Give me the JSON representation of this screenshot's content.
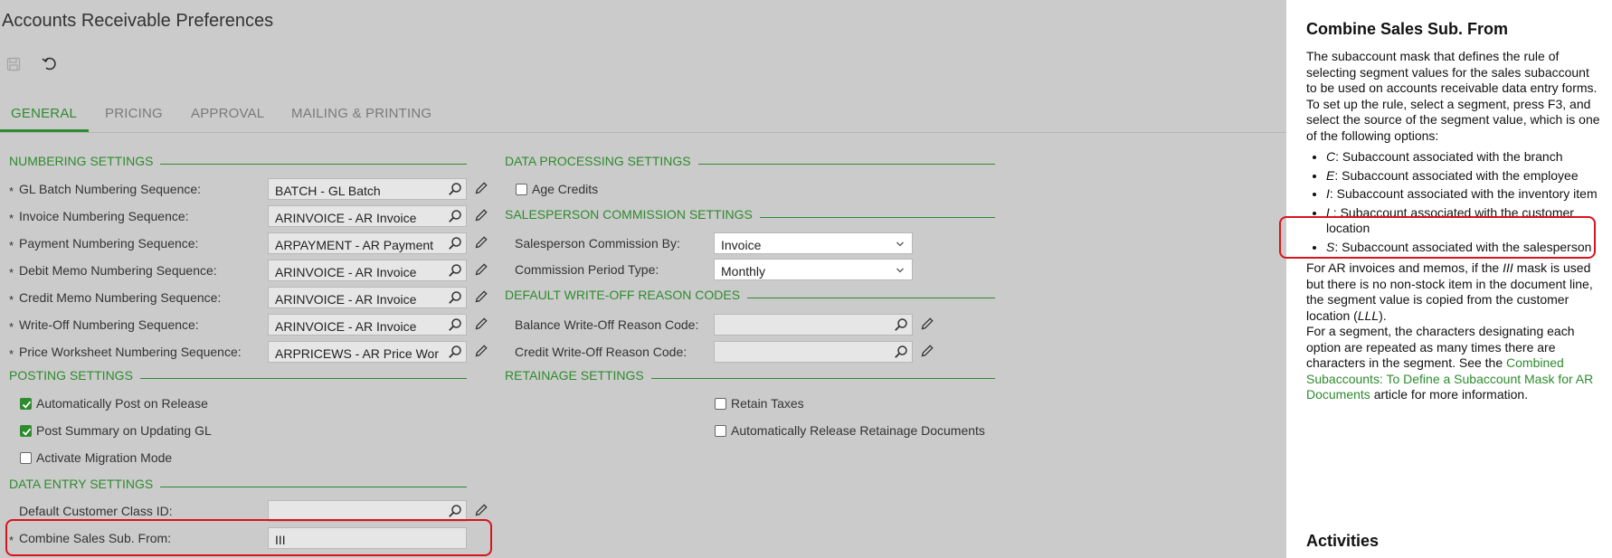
{
  "page": {
    "title": "Accounts Receivable Preferences"
  },
  "toolbar": {
    "save_icon": "save-icon",
    "undo_icon": "undo-icon"
  },
  "tabs": [
    {
      "label": "GENERAL",
      "active": true
    },
    {
      "label": "PRICING",
      "active": false
    },
    {
      "label": "APPROVAL",
      "active": false
    },
    {
      "label": "MAILING & PRINTING",
      "active": false
    }
  ],
  "numbering": {
    "header": "NUMBERING SETTINGS",
    "rows": [
      {
        "label": "GL Batch Numbering Sequence:",
        "value": "BATCH - GL Batch",
        "required": "*"
      },
      {
        "label": "Invoice Numbering Sequence:",
        "value": "ARINVOICE - AR Invoice",
        "required": "*"
      },
      {
        "label": "Payment Numbering Sequence:",
        "value": "ARPAYMENT - AR Payment",
        "required": "*"
      },
      {
        "label": "Debit Memo Numbering Sequence:",
        "value": "ARINVOICE - AR Invoice",
        "required": "*"
      },
      {
        "label": "Credit Memo Numbering Sequence:",
        "value": "ARINVOICE - AR Invoice",
        "required": "*"
      },
      {
        "label": "Write-Off Numbering Sequence:",
        "value": "ARINVOICE - AR Invoice",
        "required": "*"
      },
      {
        "label": "Price Worksheet Numbering Sequence:",
        "value": "ARPRICEWS - AR Price Worksheet",
        "required": "*"
      }
    ]
  },
  "posting": {
    "header": "POSTING SETTINGS",
    "items": [
      {
        "label": "Automatically Post on Release",
        "checked": true
      },
      {
        "label": "Post Summary on Updating GL",
        "checked": true
      },
      {
        "label": "Activate Migration Mode",
        "checked": false
      }
    ]
  },
  "data_entry": {
    "header": "DATA ENTRY SETTINGS",
    "customer_class_label": "Default Customer Class ID:",
    "customer_class_value": "",
    "combine_sales_label": "Combine Sales Sub. From:",
    "combine_sales_value": "III",
    "required": "*"
  },
  "data_processing": {
    "header": "DATA PROCESSING SETTINGS",
    "age_credits_label": "Age Credits",
    "age_credits_checked": false
  },
  "commission": {
    "header": "SALESPERSON COMMISSION SETTINGS",
    "by_label": "Salesperson Commission By:",
    "by_value": "Invoice",
    "period_label": "Commission Period Type:",
    "period_value": "Monthly"
  },
  "writeoff": {
    "header": "DEFAULT WRITE-OFF REASON CODES",
    "balance_label": "Balance Write-Off Reason Code:",
    "balance_value": "",
    "credit_label": "Credit Write-Off Reason Code:",
    "credit_value": ""
  },
  "retainage": {
    "header": "RETAINAGE SETTINGS",
    "retain_taxes_label": "Retain Taxes",
    "retain_taxes_checked": false,
    "auto_release_label": "Automatically Release Retainage Documents",
    "auto_release_checked": false
  },
  "help": {
    "title": "Combine Sales Sub. From",
    "p1": "The subaccount mask that defines the rule of selecting segment values for the sales subaccount to be used on accounts receivable data entry forms.",
    "p2": "To set up the rule, select a segment, press F3, and select the source of the segment value, which is one of the following options:",
    "options": [
      {
        "code": "C",
        "text": ": Subaccount associated with the branch"
      },
      {
        "code": "E",
        "text": ": Subaccount associated with the employee"
      },
      {
        "code": "I",
        "text": ": Subaccount associated with the inventory item"
      },
      {
        "code": "L",
        "text": ": Subaccount associated with the customer location"
      },
      {
        "code": "S",
        "text": ": Subaccount associated with the salesperson"
      }
    ],
    "p3_a": "For AR invoices and memos, if the ",
    "p3_mask": "III",
    "p3_b": " mask is used but there is no non-stock item in the document line, the segment value is copied from the customer location (",
    "p3_lll": "LLL",
    "p3_c": ").",
    "p4": "For a segment, the characters designating each option are repeated as many times there are characters in the segment. See the ",
    "link": "Combined Subaccounts: To Define a Subaccount Mask for AR Documents",
    "p4_end": " article for more information.",
    "activities": "Activities"
  },
  "colors": {
    "accent": "#2e8b2e",
    "highlight": "#d9141c",
    "panel_bg": "#cbcbcb"
  }
}
